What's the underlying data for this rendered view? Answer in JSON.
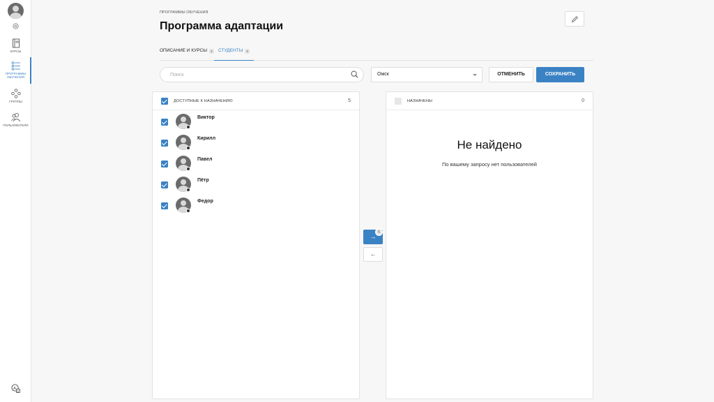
{
  "sidebar": {
    "items": [
      {
        "label": "КУРСЫ",
        "icon": "book-icon"
      },
      {
        "label": "ПРОГРАММЫ ОБУЧЕНИЯ",
        "icon": "program-list-icon",
        "active": true
      },
      {
        "label": "ГРУППЫ",
        "icon": "groups-icon"
      },
      {
        "label": "ПОЛЬЗОВАТЕЛИ",
        "icon": "users-icon"
      }
    ]
  },
  "header": {
    "breadcrumb": "ПРОГРАММЫ ОБУЧЕНИЯ",
    "title": "Программа адаптации"
  },
  "tabs": [
    {
      "label": "ОПИСАНИЕ И КУРСЫ",
      "count": "3"
    },
    {
      "label": "СТУДЕНТЫ",
      "count": "0"
    }
  ],
  "toolbar": {
    "search_placeholder": "Поиск",
    "search_value": "",
    "city": "Омск",
    "cancel_label": "ОТМЕНИТЬ",
    "save_label": "СОХРАНИТЬ"
  },
  "available": {
    "label": "ДОСТУПНЫЕ К НАЗНАЧЕНИЮ",
    "count": "5",
    "users": [
      {
        "name": "Виктор",
        "checked": true
      },
      {
        "name": "Кирилл",
        "checked": true
      },
      {
        "name": "Павел",
        "checked": true
      },
      {
        "name": "Пётр",
        "checked": true
      },
      {
        "name": "Федор",
        "checked": true
      }
    ]
  },
  "assigned": {
    "label": "НАЗНАЧЕНЫ",
    "count": "0",
    "empty_title": "Не найдено",
    "empty_subtitle": "По вашему запросу нет пользователей"
  },
  "transfer": {
    "right_arrow": "→",
    "left_arrow": "←",
    "selected_count": "5"
  },
  "colors": {
    "accent": "#3b82c4"
  }
}
